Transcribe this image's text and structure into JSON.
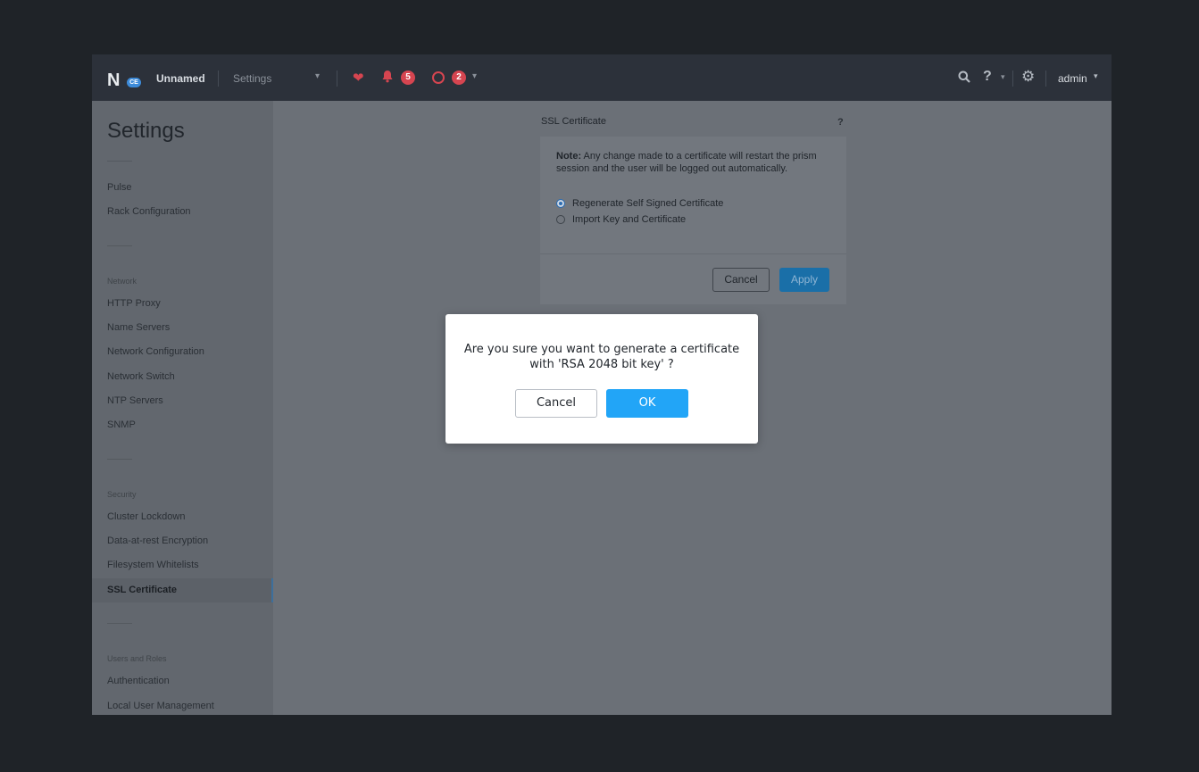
{
  "header": {
    "logo_letter": "N",
    "logo_badge": "CE",
    "cluster_name": "Unnamed",
    "nav_label": "Settings",
    "alerts_count": "5",
    "tasks_count": "2",
    "user": "admin"
  },
  "sidebar": {
    "title": "Settings",
    "items_general": [
      {
        "label": "Pulse"
      },
      {
        "label": "Rack Configuration"
      }
    ],
    "network": {
      "heading": "Network",
      "items": [
        {
          "label": "HTTP Proxy"
        },
        {
          "label": "Name Servers"
        },
        {
          "label": "Network Configuration"
        },
        {
          "label": "Network Switch"
        },
        {
          "label": "NTP Servers"
        },
        {
          "label": "SNMP"
        }
      ]
    },
    "security": {
      "heading": "Security",
      "items": [
        {
          "label": "Cluster Lockdown"
        },
        {
          "label": "Data-at-rest Encryption"
        },
        {
          "label": "Filesystem Whitelists"
        },
        {
          "label": "SSL Certificate"
        }
      ]
    },
    "users": {
      "heading": "Users and Roles",
      "items": [
        {
          "label": "Authentication"
        },
        {
          "label": "Local User Management"
        }
      ]
    }
  },
  "ssl": {
    "title": "SSL Certificate",
    "help": "?",
    "note_label": "Note:",
    "note_text": " Any change made to a certificate will restart the prism session and the user will be logged out automatically.",
    "options": [
      {
        "label": "Regenerate Self Signed Certificate",
        "selected": true
      },
      {
        "label": "Import Key and Certificate",
        "selected": false
      }
    ],
    "cancel_label": "Cancel",
    "apply_label": "Apply"
  },
  "modal": {
    "line1": "Are you sure you want to generate a certificate",
    "line2": "with 'RSA 2048 bit key' ?",
    "cancel_label": "Cancel",
    "ok_label": "OK"
  },
  "colors": {
    "accent": "#22a5f7",
    "alert": "#d64550"
  }
}
